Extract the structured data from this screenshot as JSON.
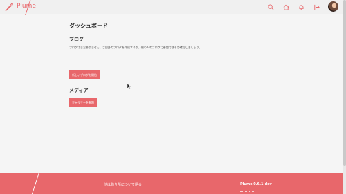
{
  "header": {
    "brand": "Plume",
    "nav": [
      {
        "name": "search-icon"
      },
      {
        "name": "home-icon"
      },
      {
        "name": "bell-icon"
      },
      {
        "name": "logout-icon"
      }
    ]
  },
  "main": {
    "title": "ダッシュボード",
    "blogs": {
      "heading": "ブログ",
      "description": "ブログはまだありません。ご自身のブログを作成するか、他の人のブログに参加できるか確認しましょう。",
      "button": "新しいブログを開始"
    },
    "media": {
      "heading": "メディア",
      "button": "ギャラリーを参照"
    }
  },
  "footer": {
    "about": "他は飾り所について語る",
    "version": "Plume 0.6.1-dev"
  },
  "colors": {
    "accent": "#e8676b",
    "background": "#f5f5f5"
  }
}
